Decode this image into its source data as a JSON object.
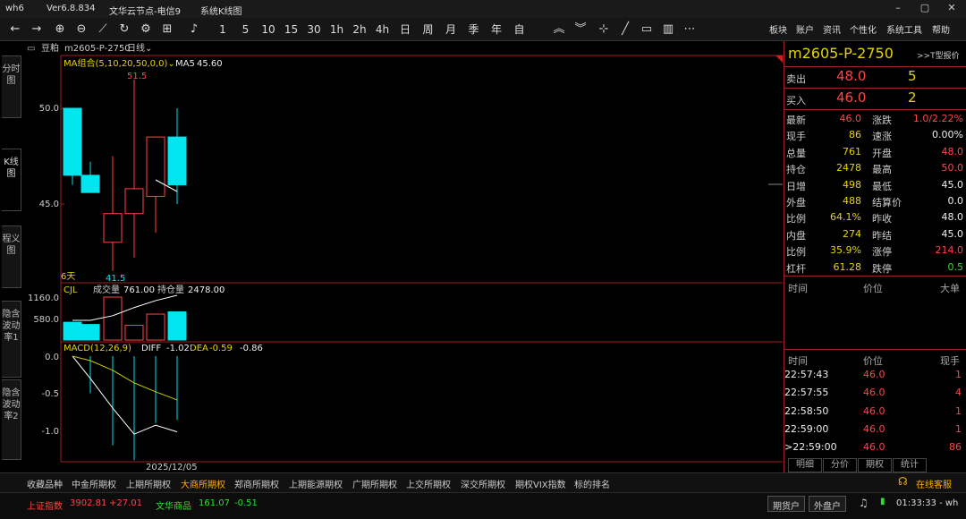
{
  "titlebar": {
    "app": "wh6",
    "version": "Ver6.8.834",
    "node": "文华云节点-电信9",
    "window": "系统K线图"
  },
  "toolbar": {
    "back": "←",
    "forward": "→",
    "periods": [
      "1",
      "5",
      "10",
      "15",
      "30",
      "1h",
      "2h",
      "4h",
      "日",
      "周",
      "月",
      "季",
      "年",
      "自"
    ],
    "right_menu": [
      "板块",
      "账户",
      "资讯",
      "个性化",
      "系统工具",
      "帮助"
    ]
  },
  "left_tabs": [
    "分时图",
    "K线图",
    "程义图",
    "隐含波动率1",
    "隐含波动率2"
  ],
  "chart": {
    "header": {
      "icon_text": "豆粕",
      "contract": "m2605-P-2750",
      "period": "日线"
    },
    "ma_label": "MA组合(5,10,20,50,0,0)",
    "ma5_label": "MA5",
    "ma5_value": "45.60",
    "max_label": "51.5",
    "min_label": "41.5",
    "count_label": "6天",
    "y_ticks": [
      "50.0",
      "45.0"
    ],
    "vol_label": "CJL",
    "vol_text": "成交量",
    "vol_value": "761.00",
    "oi_text": "持仓量",
    "oi_value": "2478.00",
    "vol_ticks": [
      "1160.0",
      "580.0"
    ],
    "macd_label": "MACD(12,26,9)",
    "diff_label": "DIFF",
    "diff_value": "-1.02",
    "dea_label": "DEA",
    "dea_value": "-0.59",
    "macd_value": "-0.86",
    "macd_ticks": [
      "0.0",
      "-0.5",
      "-1.0"
    ],
    "date_label": "2025/12/05"
  },
  "chart_data": {
    "type": "candlestick",
    "candles": [
      {
        "open": 50.0,
        "high": 50.0,
        "low": 46.0,
        "close": 46.5
      },
      {
        "open": 46.5,
        "high": 47.2,
        "low": 45.6,
        "close": 45.6
      },
      {
        "open": 43.0,
        "high": 47.5,
        "low": 41.5,
        "close": 44.5
      },
      {
        "open": 44.5,
        "high": 51.5,
        "low": 42.2,
        "close": 45.8
      },
      {
        "open": 45.4,
        "high": 47.5,
        "low": 43.5,
        "close": 48.5
      },
      {
        "open": 48.5,
        "high": 50.0,
        "low": 45.0,
        "close": 46.0
      }
    ],
    "volume": [
      480,
      420,
      1160,
      400,
      700,
      761
    ],
    "open_interest": [
      1400,
      1400,
      1600,
      1950,
      2250,
      2478
    ],
    "diff": [
      0.0,
      -0.3,
      -0.7,
      -1.05,
      -0.93,
      -1.02
    ],
    "dea": [
      0.0,
      -0.06,
      -0.19,
      -0.36,
      -0.48,
      -0.59
    ],
    "macd_bar": [
      0.0,
      -0.5,
      -1.2,
      -1.4,
      -0.9,
      -0.86
    ],
    "ma5": [
      null,
      null,
      null,
      null,
      46.5,
      45.6
    ]
  },
  "quote": {
    "symbol": "m2605-P-2750",
    "t_quote": ">>T型报价",
    "ask_label": "卖出",
    "ask_price": "48.0",
    "ask_vol": "5",
    "bid_label": "买入",
    "bid_price": "46.0",
    "bid_vol": "2",
    "rows": [
      {
        "l1": "最新",
        "v1": "46.0",
        "c1": "red",
        "l2": "涨跌",
        "v2": "1.0/2.22%",
        "c2": "red"
      },
      {
        "l1": "现手",
        "v1": "86",
        "c1": "yel",
        "l2": "速涨",
        "v2": "0.00%",
        "c2": "wht"
      },
      {
        "l1": "总量",
        "v1": "761",
        "c1": "yel",
        "l2": "开盘",
        "v2": "48.0",
        "c2": "red"
      },
      {
        "l1": "持仓",
        "v1": "2478",
        "c1": "yel",
        "l2": "最高",
        "v2": "50.0",
        "c2": "red"
      },
      {
        "l1": "日增",
        "v1": "498",
        "c1": "yel",
        "l2": "最低",
        "v2": "45.0",
        "c2": "wht"
      },
      {
        "l1": "外盘",
        "v1": "488",
        "c1": "yel",
        "l2": "结算价",
        "v2": "0.0",
        "c2": "wht"
      },
      {
        "l1": "比例",
        "v1": "64.1%",
        "c1": "yel",
        "l2": "昨收",
        "v2": "48.0",
        "c2": "wht"
      },
      {
        "l1": "内盘",
        "v1": "274",
        "c1": "yel",
        "l2": "昨结",
        "v2": "45.0",
        "c2": "wht"
      },
      {
        "l1": "比例",
        "v1": "35.9%",
        "c1": "yel",
        "l2": "涨停",
        "v2": "214.0",
        "c2": "red"
      },
      {
        "l1": "杠杆",
        "v1": "61.28",
        "c1": "yel",
        "l2": "跌停",
        "v2": "0.5",
        "c2": "grn"
      }
    ],
    "big_headers": [
      "时间",
      "价位",
      "大单"
    ],
    "tick_headers": [
      "时间",
      "价位",
      "现手"
    ],
    "ticks": [
      {
        "time": "22:57:43",
        "price": "46.0",
        "vol": "1"
      },
      {
        "time": "22:57:55",
        "price": "46.0",
        "vol": "4"
      },
      {
        "time": "22:58:50",
        "price": "46.0",
        "vol": "1"
      },
      {
        "time": "22:59:00",
        "price": "46.0",
        "vol": "1"
      },
      {
        "time": ">22:59:00",
        "price": "46.0",
        "vol": "86"
      }
    ],
    "bottom_tabs": [
      "明细",
      "分价",
      "期权",
      "统计"
    ]
  },
  "exchange_tabs": [
    "收藏品种",
    "中金所期权",
    "上期所期权",
    "大商所期权",
    "郑商所期权",
    "上期能源期权",
    "广期所期权",
    "上交所期权",
    "深交所期权",
    "期权VIX指数",
    "标的排名"
  ],
  "online_service": "在线客服",
  "status": {
    "sh_label": "上证指数",
    "sh_value": "3902.81",
    "sh_change": "+27.01",
    "wh_label": "文华商品",
    "wh_value": "161.07",
    "wh_change": "-0.51",
    "btn1": "期货户",
    "btn2": "外盘户",
    "clock": "01:33:33 - wh"
  },
  "colors": {
    "up": "#ff4545",
    "down": "#00e5ee",
    "ma5": "#ffffff",
    "diff": "#ffffff",
    "dea": "#c8c800",
    "selected_tab": "#ffb000"
  }
}
